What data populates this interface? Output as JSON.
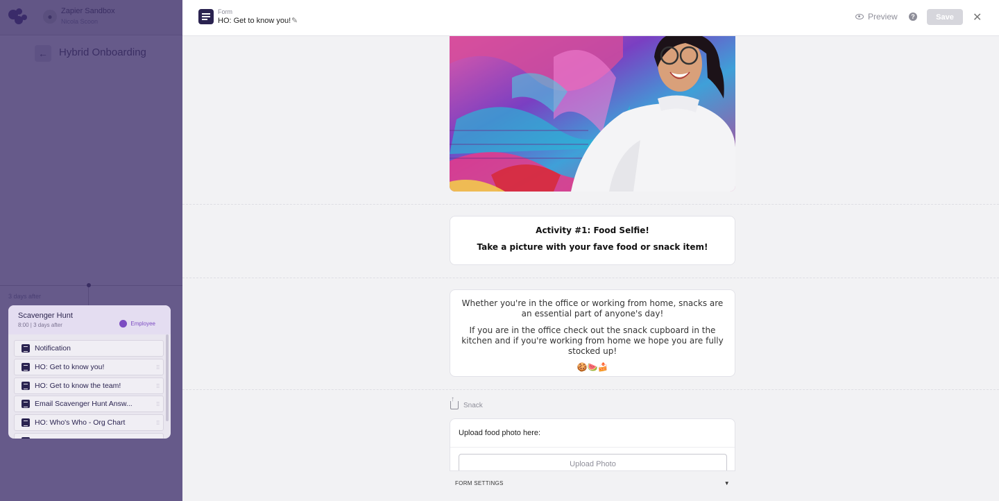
{
  "sidebar": {
    "account_name": "Zapier Sandbox",
    "account_user": "Nicola Scoon",
    "flow_title": "Hybrid Onboarding",
    "delay_label": "3 days after",
    "card": {
      "title": "Scavenger Hunt",
      "subtitle": "8:00 | 3 days after",
      "assignee": "Employee",
      "steps": [
        {
          "label": "Notification",
          "icon": "bell-icon"
        },
        {
          "label": "HO: Get to know you!",
          "icon": "form-icon"
        },
        {
          "label": "HO: Get to know the team!",
          "icon": "form-icon"
        },
        {
          "label": "Email Scavenger Hunt Answ...",
          "icon": "email-icon"
        },
        {
          "label": "HO: Who's Who - Org Chart",
          "icon": "content-icon"
        }
      ]
    }
  },
  "header": {
    "type_label": "Form",
    "form_name": "HO: Get to know you!",
    "preview_label": "Preview",
    "save_label": "Save"
  },
  "content": {
    "activity_title": "Activity #1: Food Selfie!",
    "activity_subtitle": "Take a picture with your fave food or snack item!",
    "para1": "Whether you're in the office or working from home, snacks are an essential part of anyone's day!",
    "para2": "If you are in the office check out the snack cupboard in the kitchen and if you're working from home we hope you are fully stocked up!",
    "emoji": "🍪🍉🍰",
    "field_label": "Snack",
    "upload_title": "Upload food photo here:",
    "upload_button": "Upload Photo",
    "settings_label": "FORM SETTINGS"
  },
  "colors": {
    "sidebar_overlay": "#665a8a",
    "brand_dark": "#2a2350",
    "accent_purple": "#7c4cc2",
    "save_disabled": "#d6d6dc"
  }
}
